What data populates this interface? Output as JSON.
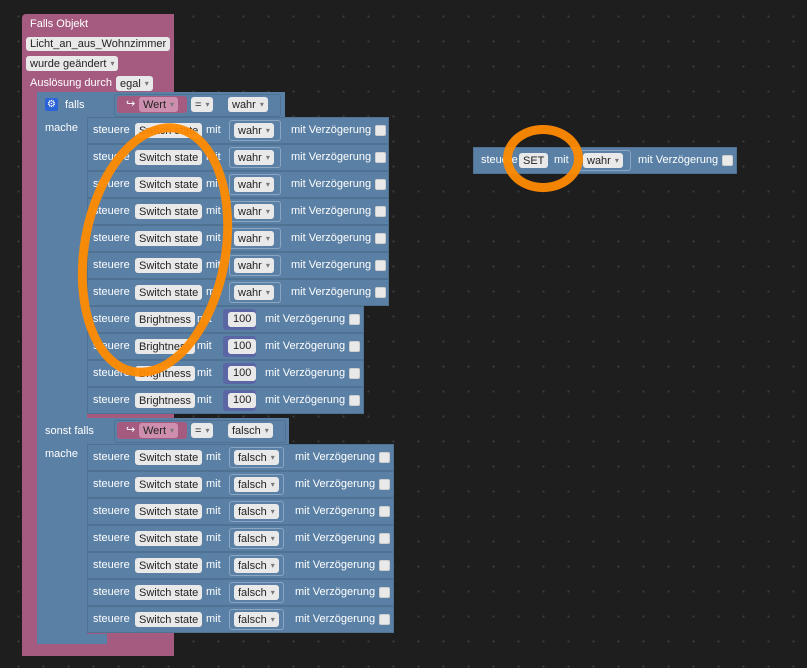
{
  "event_block": {
    "title": "Falls Objekt",
    "object_id": "Licht_an_aus_Wohnzimmer",
    "condition": "wurde geändert",
    "trigger_label": "Auslösung durch",
    "trigger_value": "egal"
  },
  "if_block": {
    "if_label": "falls",
    "do_label": "mache",
    "elseif_label": "sonst falls",
    "do2_label": "mache",
    "compare_var": "Wert",
    "compare_op": "=",
    "if_value": "wahr",
    "elseif_value": "falsch"
  },
  "common": {
    "verb": "steuere",
    "with": "mit",
    "delay": "mit Verzögerung"
  },
  "then_rows": [
    {
      "target": "Switch state",
      "value": "wahr"
    },
    {
      "target": "Switch state",
      "value": "wahr"
    },
    {
      "target": "Switch state",
      "value": "wahr"
    },
    {
      "target": "Switch state",
      "value": "wahr"
    },
    {
      "target": "Switch state",
      "value": "wahr"
    },
    {
      "target": "Switch state",
      "value": "wahr"
    },
    {
      "target": "Switch state",
      "value": "wahr"
    }
  ],
  "brightness_rows": [
    {
      "target": "Brightness",
      "value": "100"
    },
    {
      "target": "Brightness",
      "value": "100"
    },
    {
      "target": "Brightness",
      "value": "100"
    },
    {
      "target": "Brightness",
      "value": "100"
    }
  ],
  "else_rows": [
    {
      "target": "Switch state",
      "value": "falsch"
    },
    {
      "target": "Switch state",
      "value": "falsch"
    },
    {
      "target": "Switch state",
      "value": "falsch"
    },
    {
      "target": "Switch state",
      "value": "falsch"
    },
    {
      "target": "Switch state",
      "value": "falsch"
    },
    {
      "target": "Switch state",
      "value": "falsch"
    },
    {
      "target": "Switch state",
      "value": "falsch"
    }
  ],
  "floating_block": {
    "verb": "steuere",
    "target": "SET",
    "with": "mit",
    "value": "wahr",
    "delay": "mit Verzögerung"
  },
  "colors": {
    "event_block": "#a55b80",
    "logic_block": "#5b80a5",
    "annotation": "#ff8a00",
    "workspace": "#1e1e1e"
  }
}
